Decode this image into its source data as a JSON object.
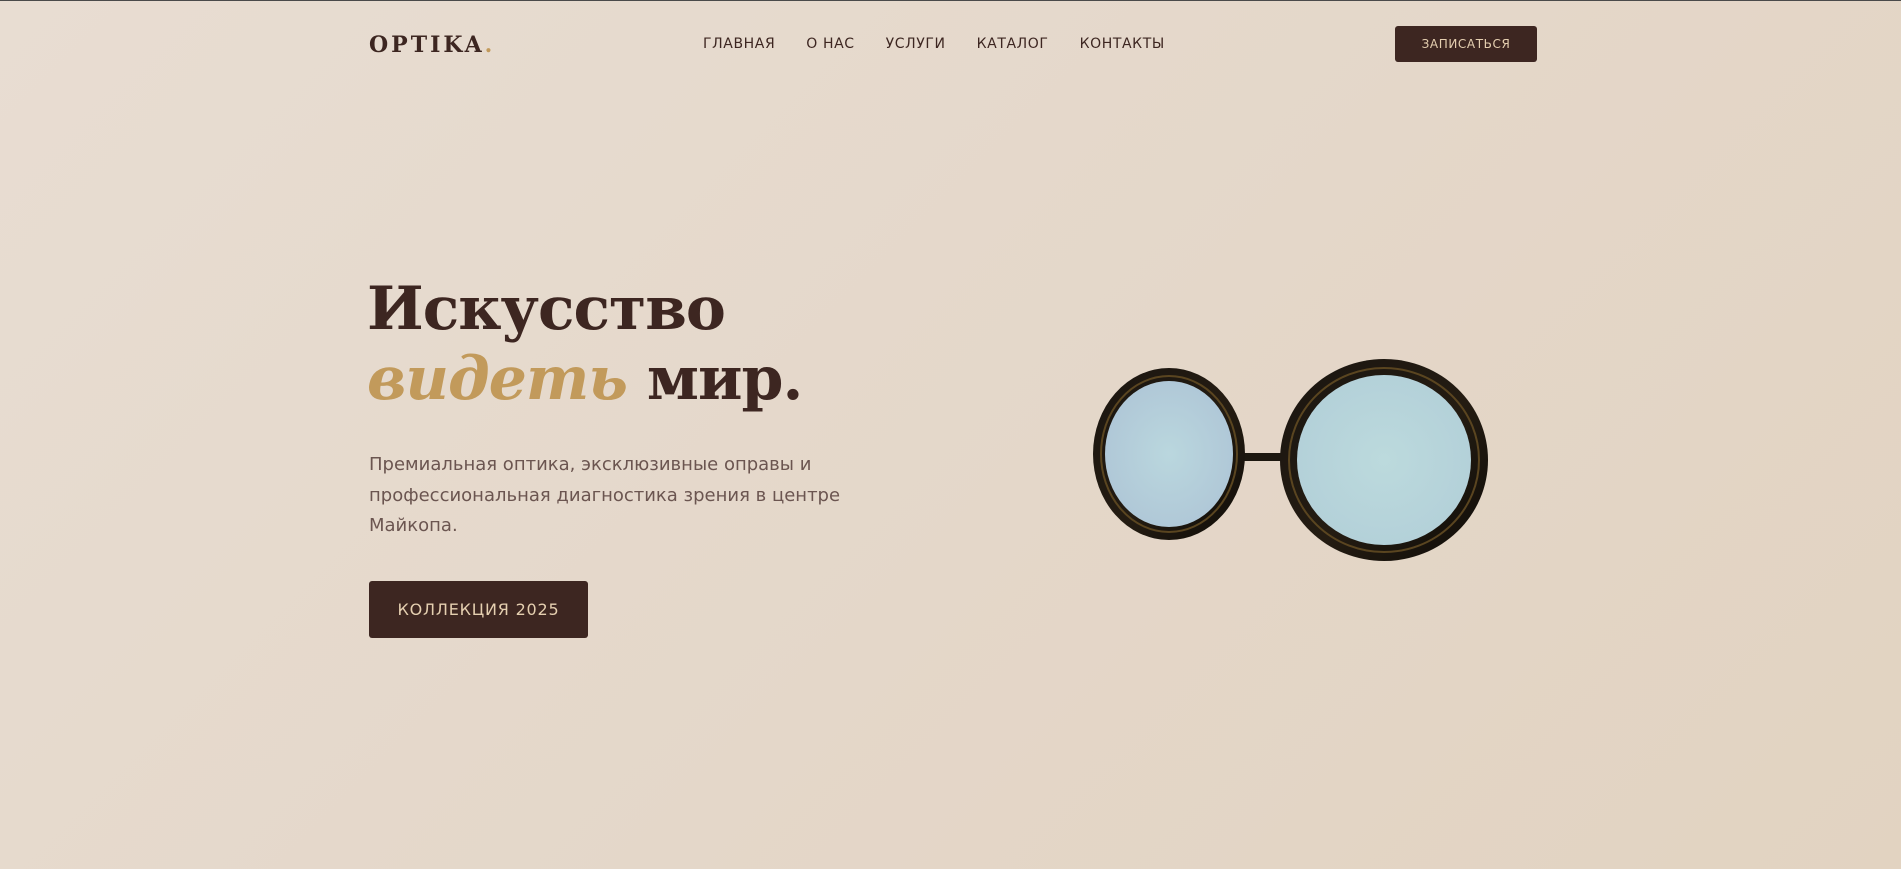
{
  "header": {
    "logo_text": "OPTIKA",
    "logo_dot": ".",
    "nav": [
      "ГЛАВНАЯ",
      "О НАС",
      "УСЛУГИ",
      "КАТАЛОГ",
      "КОНТАКТЫ"
    ],
    "cta_label": "ЗАПИСАТЬСЯ"
  },
  "hero": {
    "title_line1": "Искусство",
    "title_accent": "видеть",
    "title_rest": " мир.",
    "subtitle": "Премиальная оптика, эксклюзивные оправы и профессиональная диагностика зрения в центре Майкопа.",
    "button_label": "КОЛЛЕКЦИЯ 2025",
    "image_icon": "round-glasses-icon"
  },
  "colors": {
    "background": "#e6dacd",
    "brand_dark": "#3d2621",
    "accent_gold": "#c29a5b",
    "button_text": "#e5cfb0",
    "body_text": "#6b5550",
    "lens_tint": "#b7d3da"
  }
}
